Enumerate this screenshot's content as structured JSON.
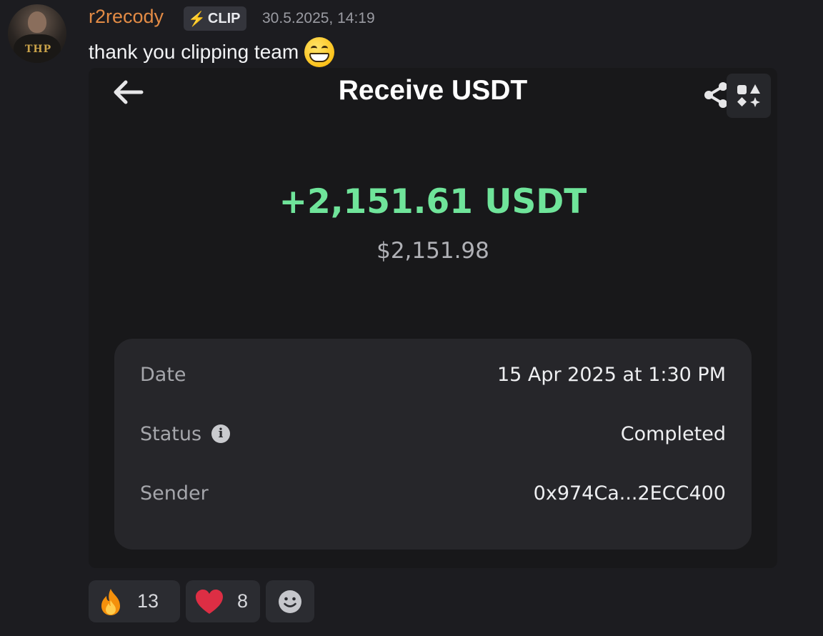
{
  "message": {
    "username": "r2recody",
    "role_tag": "CLIP",
    "timestamp": "30.5.2025, 14:19",
    "text": "thank you clipping team",
    "avatar_logo": "THP"
  },
  "card": {
    "title": "Receive USDT",
    "amount": "+2,151.61 USDT",
    "fiat_value": "$2,151.98",
    "details": [
      {
        "label": "Date",
        "value": "15 Apr 2025 at 1:30 PM"
      },
      {
        "label": "Status",
        "value": "Completed"
      },
      {
        "label": "Sender",
        "value": "0x974Ca...2ECC400"
      }
    ]
  },
  "reactions": [
    {
      "emoji": "fire-emoji",
      "count": "13"
    },
    {
      "emoji": "heart-emoji",
      "count": "8"
    },
    {
      "emoji": "add-reaction-icon",
      "count": ""
    }
  ],
  "colors": {
    "username": "#e38b45",
    "amount_green": "#6fe49a",
    "background": "#1c1c20",
    "card_bg": "#18181a",
    "details_bg": "#26262a"
  }
}
